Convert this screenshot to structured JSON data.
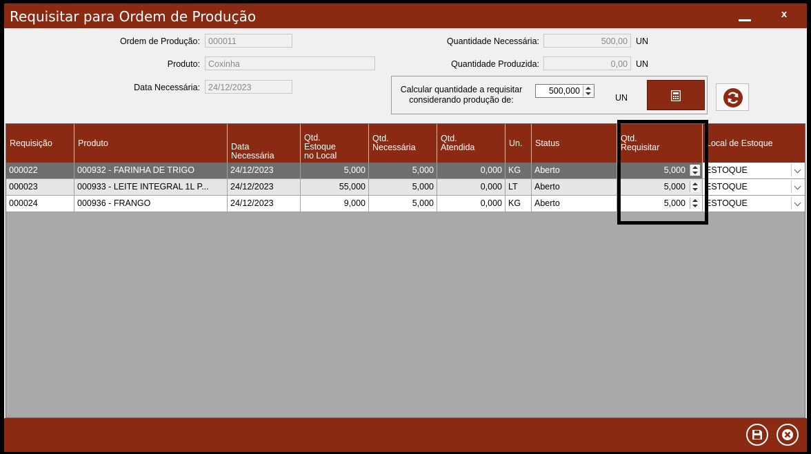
{
  "window": {
    "title": "Requisitar para Ordem de Produção",
    "close_label": "x"
  },
  "form": {
    "ordem_label": "Ordem de Produção:",
    "ordem_value": "000011",
    "produto_label": "Produto:",
    "produto_value": "Coxinha",
    "data_label": "Data Necessária:",
    "data_value": "24/12/2023",
    "qtd_nec_label": "Quantidade Necessária:",
    "qtd_nec_value": "500,00",
    "qtd_nec_unit": "UN",
    "qtd_prod_label": "Quantidade Produzida:",
    "qtd_prod_value": "0,00",
    "qtd_prod_unit": "UN"
  },
  "calc": {
    "label_line1": "Calcular quantidade a requisitar",
    "label_line2": "considerando produção de:",
    "value": "500,000",
    "unit": "UN"
  },
  "table": {
    "headers": {
      "requisicao": "Requisição",
      "produto": "Produto",
      "data_nec": [
        "Data",
        "Necessária"
      ],
      "qtd_estoque": [
        "Qtd.",
        "Estoque",
        "no Local"
      ],
      "qtd_nec": [
        "Qtd.",
        "Necessária"
      ],
      "qtd_atend": [
        "Qtd.",
        "Atendida"
      ],
      "un": "Un.",
      "status": "Status",
      "qtd_req": [
        "Qtd.",
        "Requisitar"
      ],
      "local": "Local de Estoque"
    },
    "rows": [
      {
        "req": "000022",
        "produto": "000932 - FARINHA DE TRIGO",
        "data": "24/12/2023",
        "estoque": "5,000",
        "nec": "5,000",
        "atend": "0,000",
        "un": "KG",
        "status": "Aberto",
        "qtd": "5,000",
        "local": "ESTOQUE"
      },
      {
        "req": "000023",
        "produto": "000933 - LEITE INTEGRAL 1L P...",
        "data": "24/12/2023",
        "estoque": "55,000",
        "nec": "5,000",
        "atend": "0,000",
        "un": "LT",
        "status": "Aberto",
        "qtd": "5,000",
        "local": "ESTOQUE"
      },
      {
        "req": "000024",
        "produto": "000936 - FRANGO",
        "data": "24/12/2023",
        "estoque": "9,000",
        "nec": "5,000",
        "atend": "0,000",
        "un": "KG",
        "status": "Aberto",
        "qtd": "5,000",
        "local": "ESTOQUE"
      }
    ]
  },
  "icons": {
    "calculate": "calculator-icon",
    "refresh": "refresh-icon",
    "save": "save-icon",
    "cancel": "cancel-icon"
  },
  "colors": {
    "accent": "#8b2a13",
    "selected_row": "#6e6e6e",
    "alt_row": "#e6e6e6"
  }
}
